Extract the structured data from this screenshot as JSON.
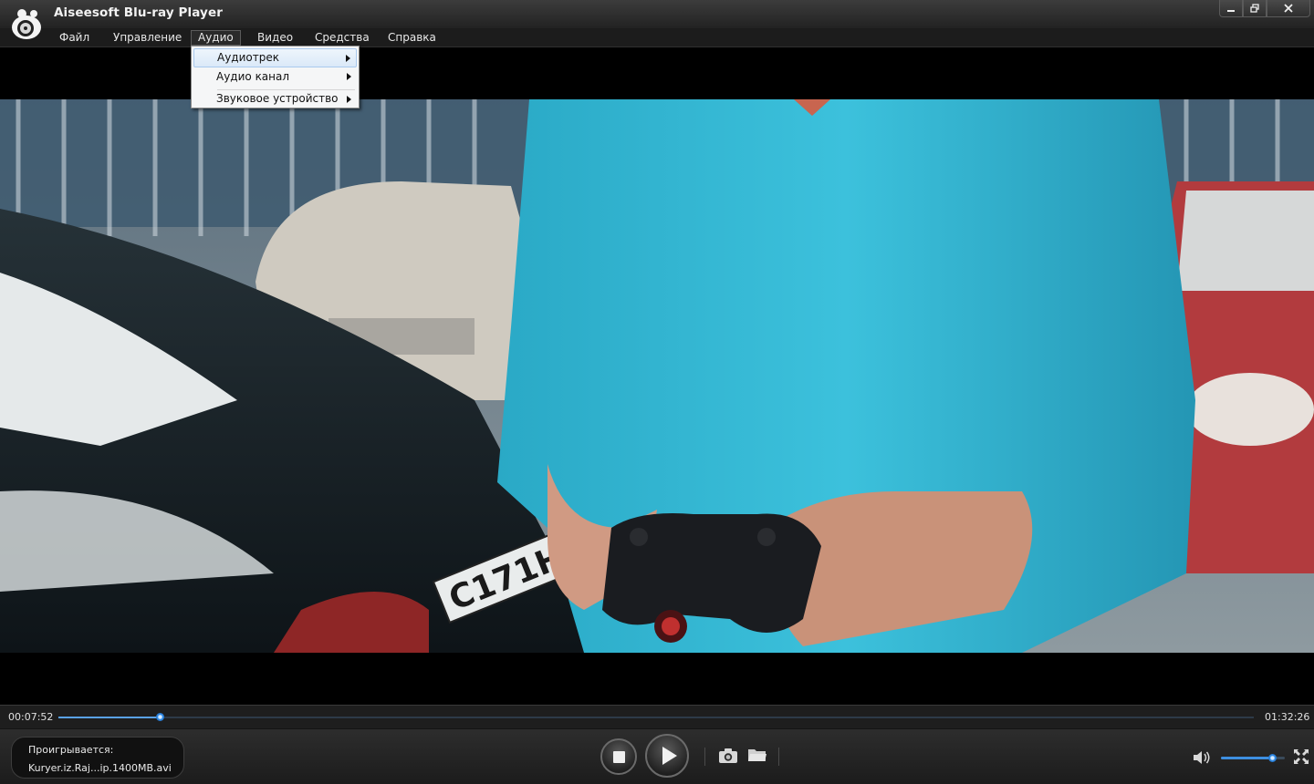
{
  "window": {
    "title": "Aiseesoft Blu-ray Player",
    "min_icon": "minimize-icon",
    "max_icon": "restore-icon",
    "close_icon": "close-icon"
  },
  "menu": {
    "items": [
      {
        "label": "Файл"
      },
      {
        "label": "Управление"
      },
      {
        "label": "Аудио"
      },
      {
        "label": "Видео"
      },
      {
        "label": "Средства"
      },
      {
        "label": "Справка"
      }
    ],
    "open_menu": "Аудио"
  },
  "audio_menu": {
    "items": [
      {
        "label": "Аудиотрек",
        "has_submenu": true,
        "highlighted": true
      },
      {
        "label": "Аудио канал",
        "has_submenu": true
      },
      {
        "label": "Звуковое устройство",
        "has_submenu": true
      }
    ]
  },
  "video": {
    "plate_text": "С171НМ 99"
  },
  "playback": {
    "current_time": "00:07:52",
    "total_time": "01:32:26",
    "progress_fraction": 0.085,
    "volume_fraction": 0.8
  },
  "now_playing": {
    "label": "Проигрывается:",
    "file": "Kuryer.iz.Raj...ip.1400MB.avi"
  },
  "icons": {
    "logo": "aiseesoft-logo-icon",
    "stop": "stop-icon",
    "play": "play-icon",
    "snapshot": "camera-icon",
    "folder": "folder-icon",
    "volume": "speaker-icon",
    "fullscreen": "fullscreen-icon"
  },
  "colors": {
    "accent": "#2f8ae6",
    "menu_highlight": "#dbe9f8"
  }
}
